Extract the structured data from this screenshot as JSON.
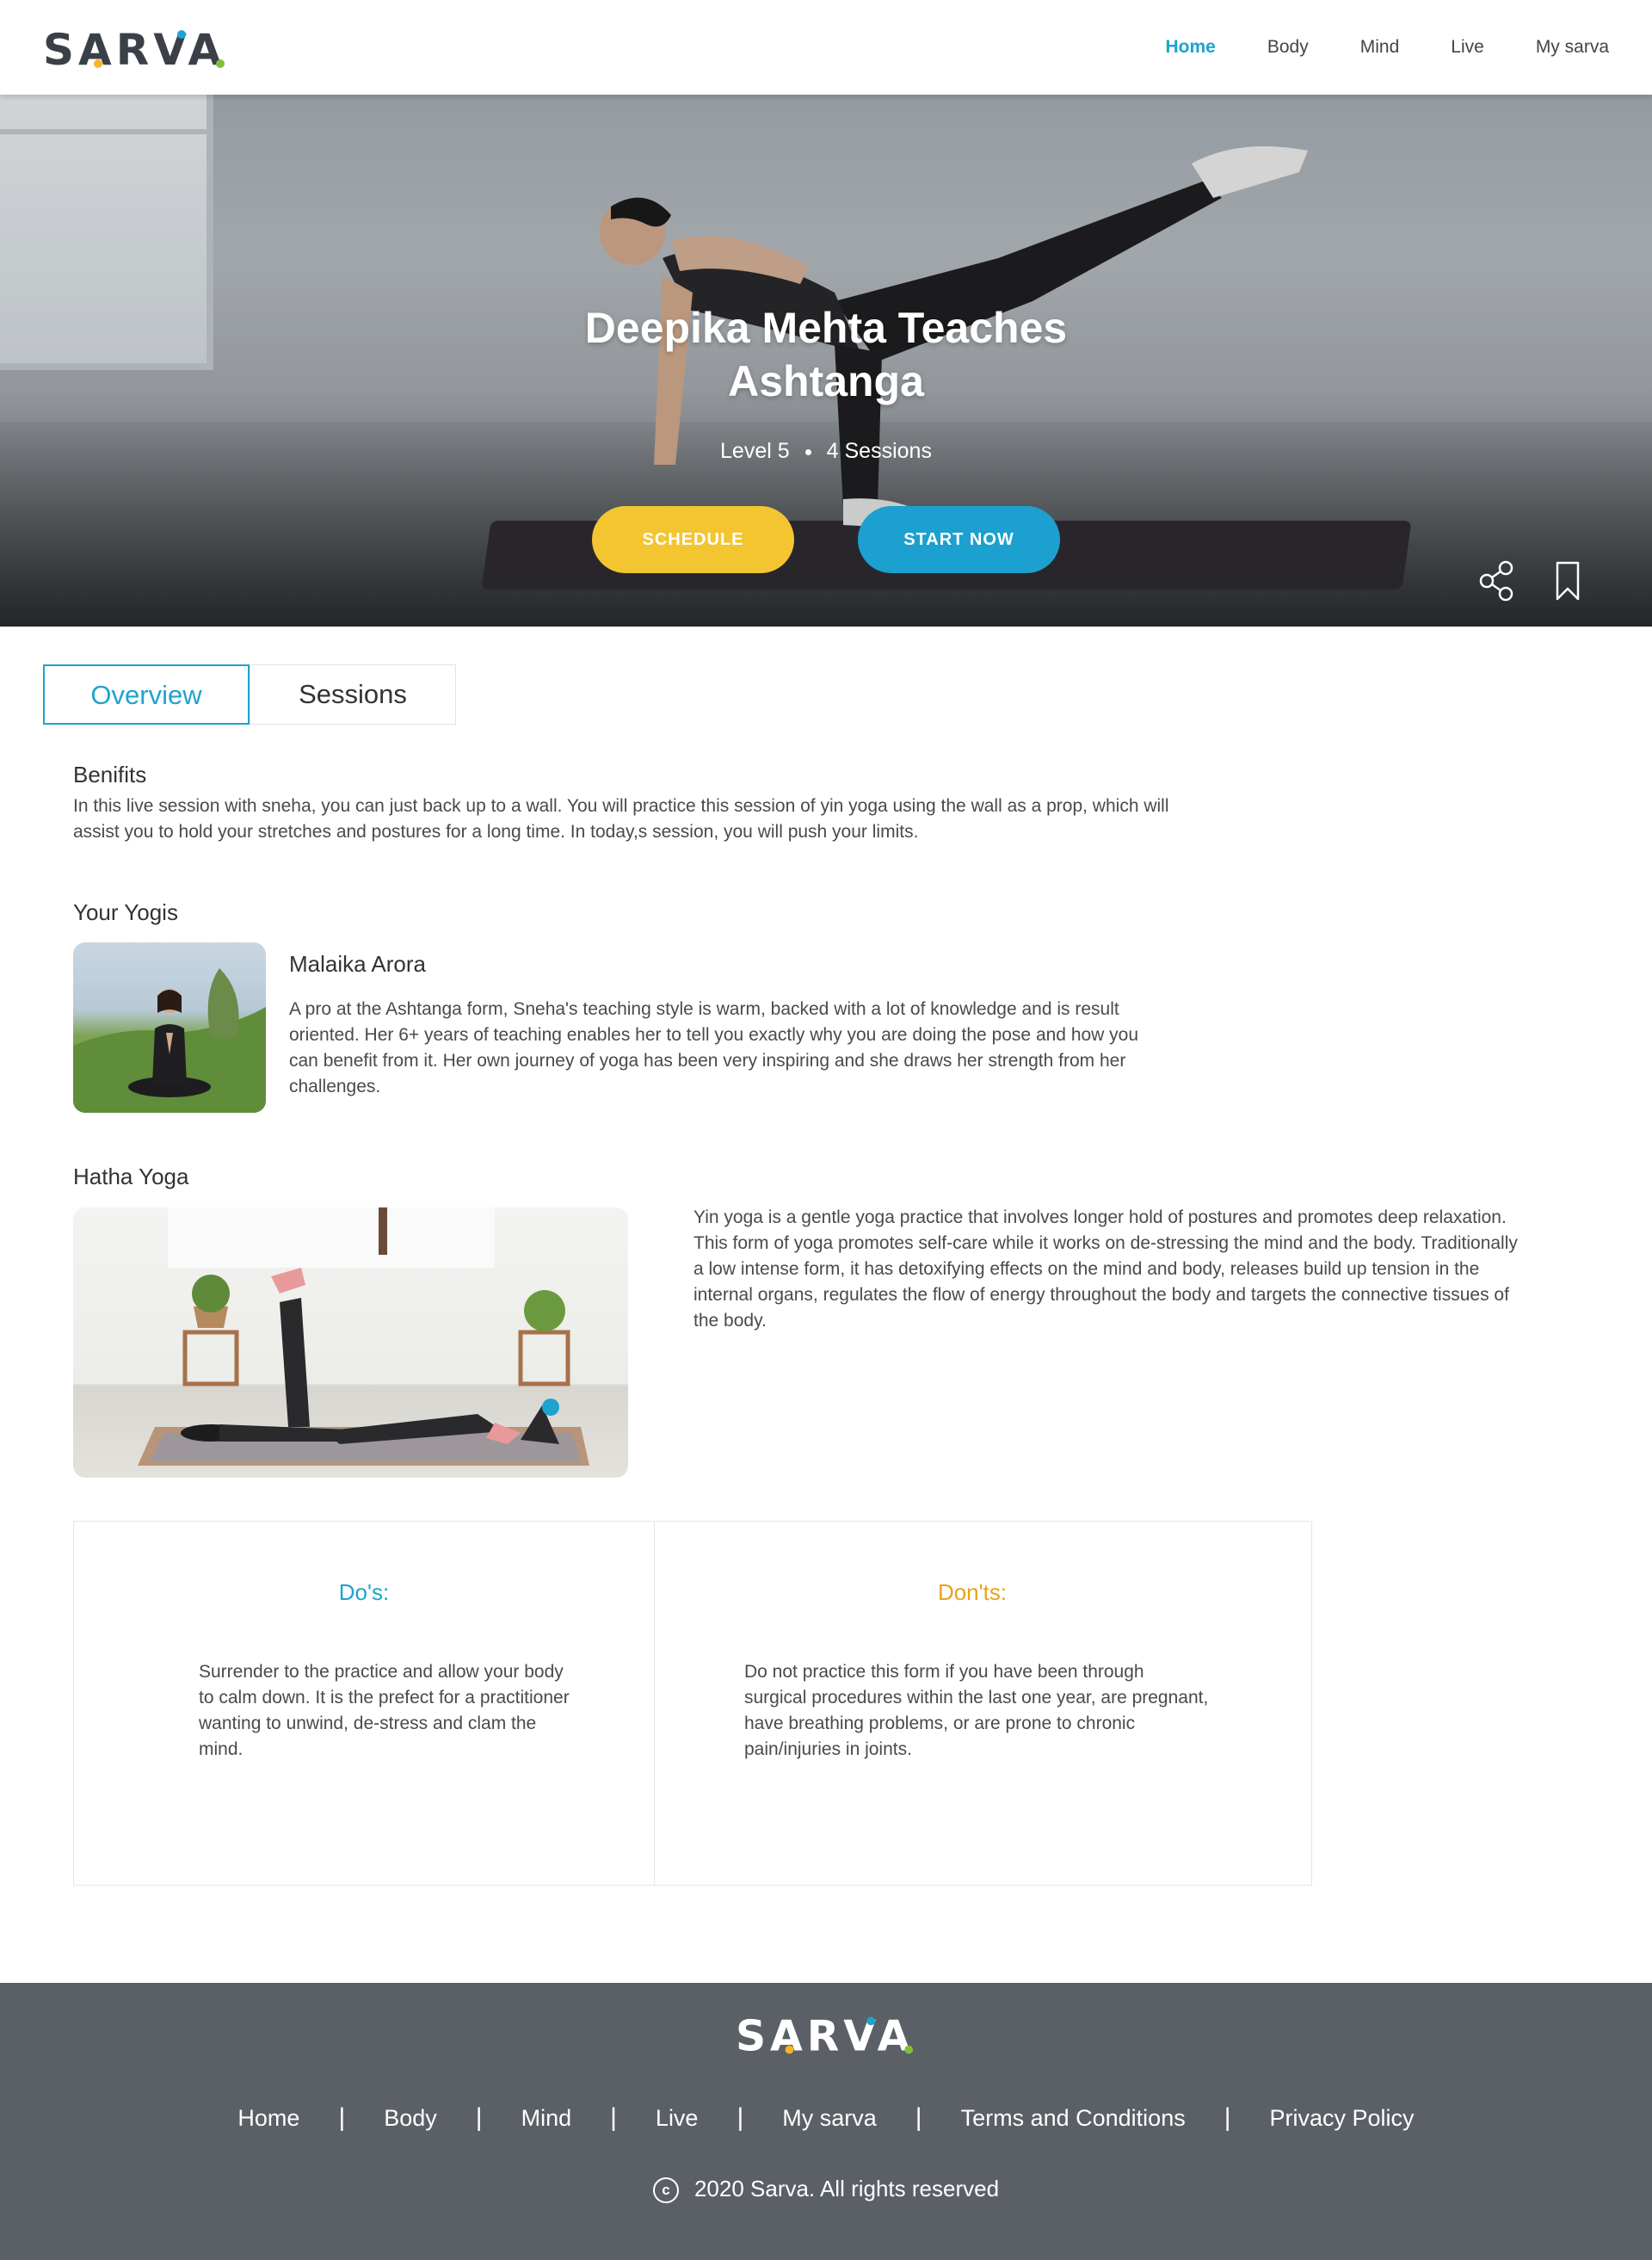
{
  "brand": {
    "name": "SARVA"
  },
  "nav": {
    "items": [
      "Home",
      "Body",
      "Mind",
      "Live",
      "My sarva"
    ],
    "active": "Home"
  },
  "hero": {
    "title": "Deepika Mehta Teaches Ashtanga",
    "level": "Level 5",
    "sessions": "4 Sessions",
    "schedule_label": "SCHEDULE",
    "start_label": "START NOW"
  },
  "tabs": [
    "Overview",
    "Sessions"
  ],
  "benefits": {
    "title": "Benifits",
    "text": "In this live session with sneha, you can just back up to a wall. You will practice this session of yin yoga using the wall as a prop, which will assist you to hold your stretches and postures for a long time. In today,s session, you will push your limits."
  },
  "yogis": {
    "title": "Your Yogis",
    "name": "Malaika Arora",
    "bio": "A pro at the Ashtanga form, Sneha's teaching style is warm, backed with a lot of knowledge and is result oriented. Her 6+ years of teaching enables her to tell you exactly why you are doing the pose and how you can benefit from it. Her own journey of yoga has been very inspiring and she draws her strength from her challenges."
  },
  "hatha": {
    "title": "Hatha Yoga",
    "text": "Yin yoga is a gentle yoga practice that involves longer hold of postures and promotes deep relaxation. This form of yoga promotes self-care while it works on de-stressing the mind and the body. Traditionally a low intense form, it has detoxifying effects on the mind and body, releases build up tension in the internal organs, regulates the flow of energy throughout the body and targets the connective tissues of the body."
  },
  "dos": {
    "title": "Do's:",
    "text": "Surrender to the practice and allow your body to calm down. It is the prefect for a practitioner wanting to unwind, de-stress and clam the mind."
  },
  "donts": {
    "title": "Don'ts:",
    "text": "Do not practice this form if you have been through surgical procedures within the last one year, are pregnant, have breathing problems, or are prone to chronic pain/injuries in joints."
  },
  "footer": {
    "links": [
      "Home",
      "Body",
      "Mind",
      "Live",
      "My sarva",
      "Terms and Conditions",
      "Privacy Policy"
    ],
    "copyright": "2020 Sarva. All rights reserved"
  },
  "colors": {
    "accent": "#1ea3cf",
    "schedule": "#f3c531",
    "donts": "#e8a31b",
    "footer_bg": "#5b5f66"
  }
}
